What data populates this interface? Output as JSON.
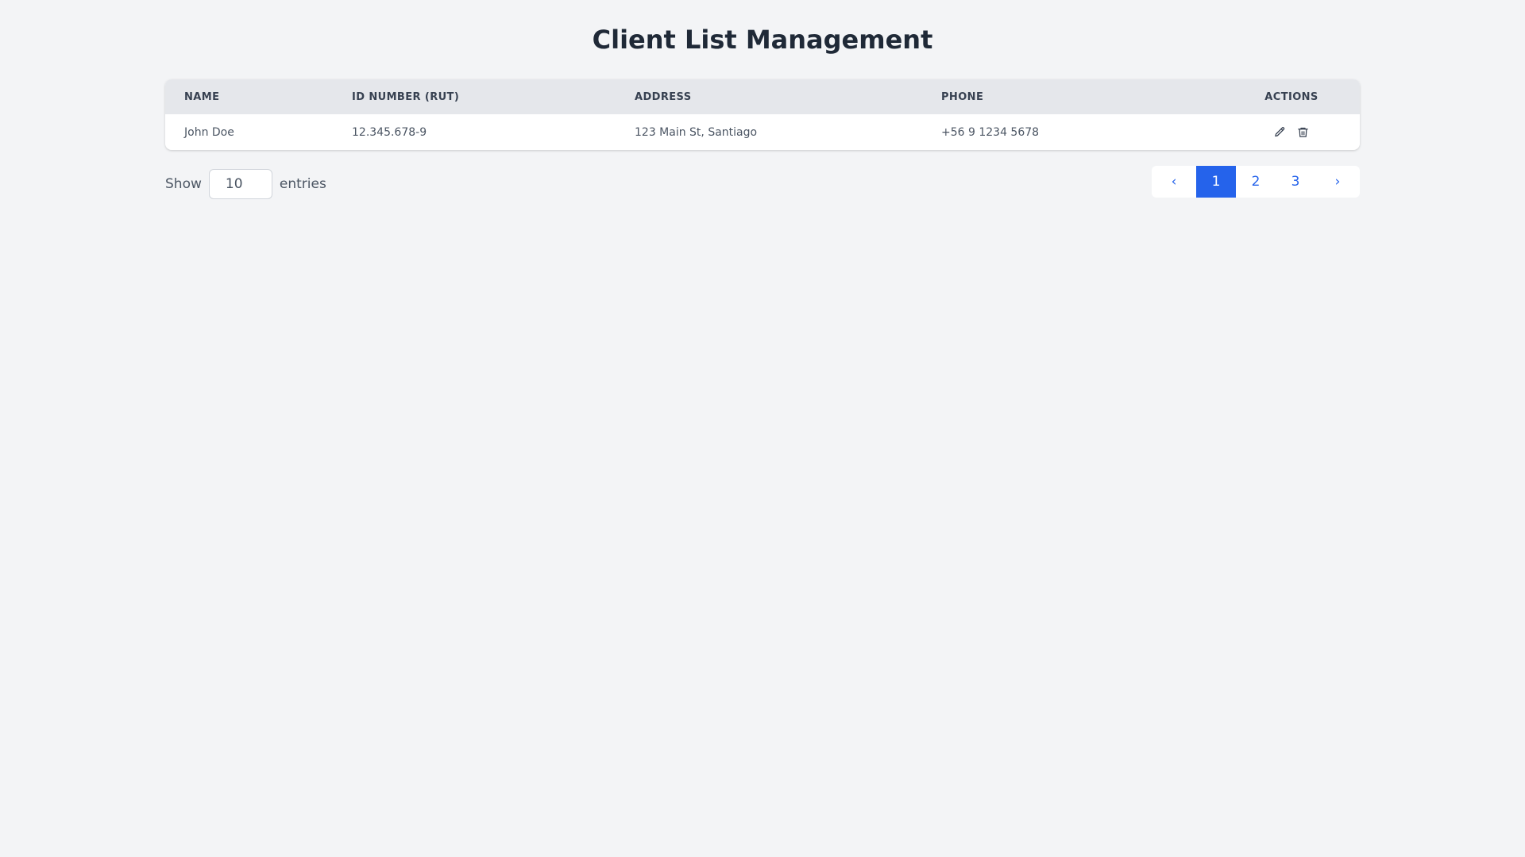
{
  "page": {
    "title": "Client List Management"
  },
  "table": {
    "headers": {
      "name": "NAME",
      "id_number": "ID NUMBER (RUT)",
      "address": "ADDRESS",
      "phone": "PHONE",
      "actions": "ACTIONS"
    },
    "rows": [
      {
        "name": "John Doe",
        "id_number": "12.345.678-9",
        "address": "123 Main St, Santiago",
        "phone": "+56 9 1234 5678",
        "actions": [
          "edit-icon",
          "trash-icon"
        ]
      }
    ]
  },
  "entries": {
    "show_label": "Show",
    "value": "10",
    "suffix_label": "entries"
  },
  "pagination": {
    "prev_label": "‹",
    "pages": [
      "1",
      "2",
      "3"
    ],
    "active_page": "1",
    "next_label": "›"
  },
  "colors": {
    "accent": "#2563eb",
    "background": "#f3f4f6",
    "header_bg": "#e5e7eb",
    "title_text": "#1f2937"
  }
}
